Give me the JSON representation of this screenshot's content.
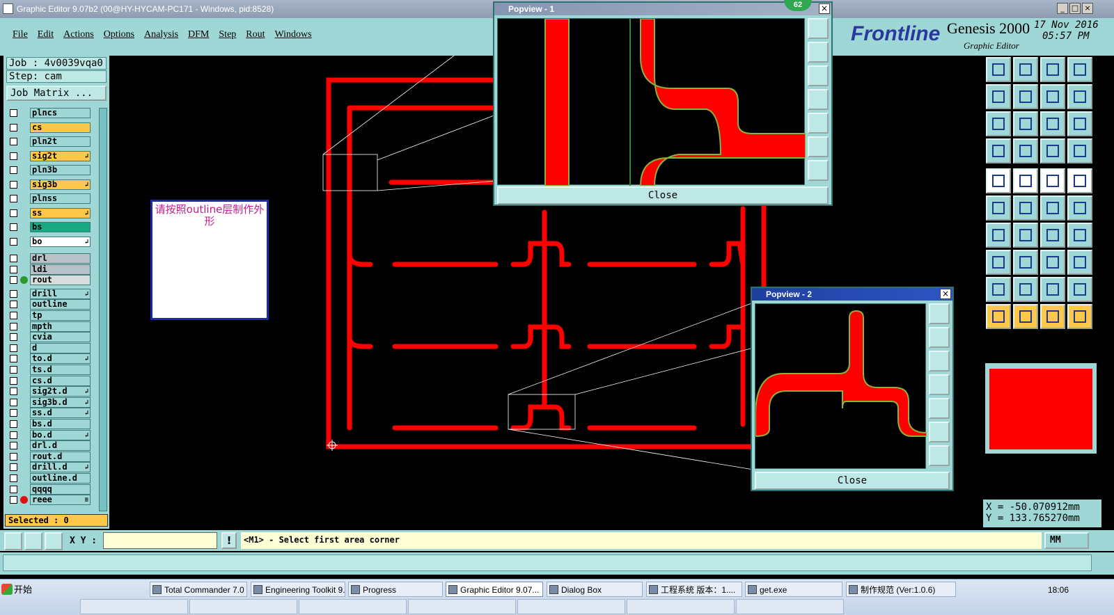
{
  "window": {
    "title": "Graphic Editor 9.07b2 (00@HY-HYCAM-PC171 - Windows, pid:8528)",
    "badge": "62"
  },
  "menu": [
    "File",
    "Edit",
    "Actions",
    "Options",
    "Analysis",
    "DFM",
    "Step",
    "Rout",
    "Windows"
  ],
  "brand": {
    "logo": "Frontline",
    "product": "Genesis 2000",
    "subtitle": "Graphic Editor",
    "date": "17 Nov 2016",
    "time": "05:57 PM"
  },
  "job": {
    "job_label": "Job : 4v0039vqa0",
    "step_label": "Step: cam",
    "matrix_button": "Job Matrix ..."
  },
  "layers": [
    {
      "name": "plncs",
      "color": "#9ed7d6",
      "mark": ""
    },
    {
      "name": "cs",
      "color": "#ffc84a",
      "mark": ""
    },
    {
      "name": "pln2t",
      "color": "#9ed7d6",
      "mark": ""
    },
    {
      "name": "sig2t",
      "color": "#ffc84a",
      "mark": "↲"
    },
    {
      "name": "pln3b",
      "color": "#9ed7d6",
      "mark": ""
    },
    {
      "name": "sig3b",
      "color": "#ffc84a",
      "mark": "↲"
    },
    {
      "name": "plnss",
      "color": "#9ed7d6",
      "mark": ""
    },
    {
      "name": "ss",
      "color": "#ffc84a",
      "mark": "↲"
    },
    {
      "name": "bs",
      "color": "#1aa882",
      "mark": ""
    },
    {
      "name": "bo",
      "color": "#ffffff",
      "mark": "↲"
    },
    {
      "name": "drl",
      "color": "#b8c0c8",
      "mark": ""
    },
    {
      "name": "ldi",
      "color": "#b8c0c8",
      "mark": ""
    },
    {
      "name": "rout",
      "color": "#d8dcdc",
      "mark": ""
    },
    {
      "name": "drill",
      "color": "#9ed7d6",
      "mark": "↲"
    },
    {
      "name": "outline",
      "color": "#9ed7d6",
      "mark": ""
    },
    {
      "name": "tp",
      "color": "#9ed7d6",
      "mark": ""
    },
    {
      "name": "mpth",
      "color": "#9ed7d6",
      "mark": ""
    },
    {
      "name": "cvia",
      "color": "#9ed7d6",
      "mark": ""
    },
    {
      "name": "d",
      "color": "#9ed7d6",
      "mark": ""
    },
    {
      "name": "to.d",
      "color": "#9ed7d6",
      "mark": "↲"
    },
    {
      "name": "ts.d",
      "color": "#9ed7d6",
      "mark": ""
    },
    {
      "name": "cs.d",
      "color": "#9ed7d6",
      "mark": ""
    },
    {
      "name": "sig2t.d",
      "color": "#9ed7d6",
      "mark": "↲"
    },
    {
      "name": "sig3b.d",
      "color": "#9ed7d6",
      "mark": "↲"
    },
    {
      "name": "ss.d",
      "color": "#9ed7d6",
      "mark": "↲"
    },
    {
      "name": "bs.d",
      "color": "#9ed7d6",
      "mark": ""
    },
    {
      "name": "bo.d",
      "color": "#9ed7d6",
      "mark": "↲"
    },
    {
      "name": "drl.d",
      "color": "#9ed7d6",
      "mark": ""
    },
    {
      "name": "rout.d",
      "color": "#9ed7d6",
      "mark": ""
    },
    {
      "name": "drill.d",
      "color": "#9ed7d6",
      "mark": "↲"
    },
    {
      "name": "outline.d",
      "color": "#9ed7d6",
      "mark": ""
    },
    {
      "name": "qqqq",
      "color": "#9ed7d6",
      "mark": ""
    },
    {
      "name": "reee",
      "color": "#9ed7d6",
      "mark": "≡"
    }
  ],
  "selected_label": "Selected : 0",
  "note": "请按照outline层制作外形",
  "popview1": {
    "title": "Popview - 1",
    "close": "Close"
  },
  "popview2": {
    "title": "Popview - 2",
    "close": "Close"
  },
  "coords": {
    "x": "X = -50.070912mm",
    "y": "Y = 133.765270mm"
  },
  "bottom": {
    "xy_label": "X Y :",
    "prompt": "<M1> - Select first area corner",
    "unit": "MM",
    "excl": "!"
  },
  "taskbar": {
    "start": "开始",
    "items": [
      "Total Commander 7.0 ...",
      "Engineering Toolkit 9....",
      "Progress",
      "Graphic Editor 9.07...",
      "Dialog Box",
      "工程系统  版本：1....",
      "get.exe",
      "制作规范 (Ver:1.0.6)"
    ],
    "clock": "18:06"
  }
}
